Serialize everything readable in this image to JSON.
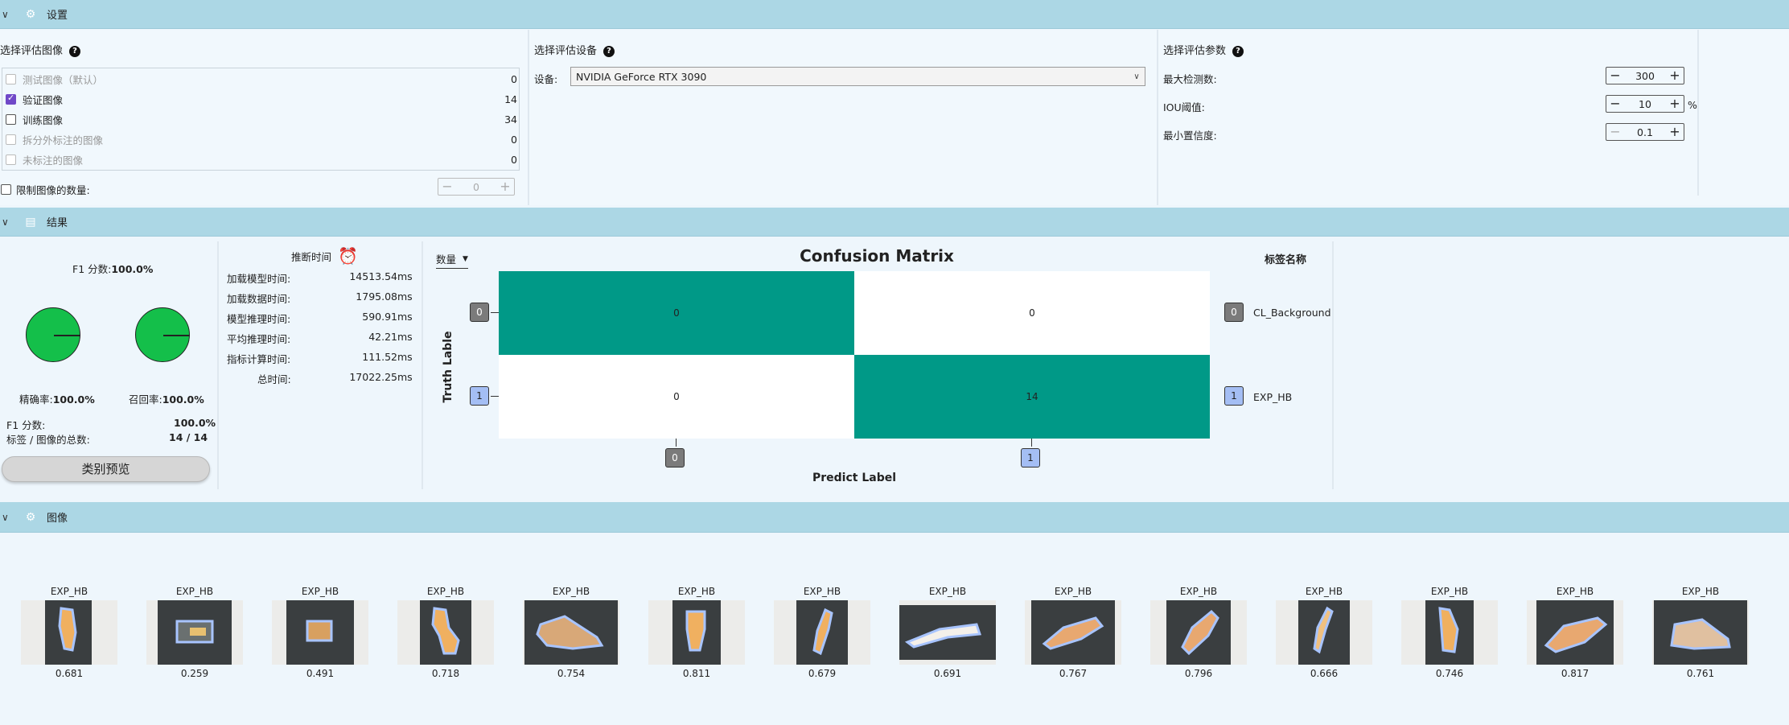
{
  "settings": {
    "title": "设置",
    "images": {
      "heading": "选择评估图像",
      "rows": [
        {
          "name": "测试图像（默认）",
          "count": "0"
        },
        {
          "name": "验证图像",
          "count": "14"
        },
        {
          "name": "训练图像",
          "count": "34"
        },
        {
          "name": "拆分外标注的图像",
          "count": "0"
        },
        {
          "name": "未标注的图像",
          "count": "0"
        }
      ],
      "limit_label": "限制图像的数量:",
      "limit_value": "0"
    },
    "device": {
      "heading": "选择评估设备",
      "label": "设备:",
      "value": "NVIDIA GeForce RTX 3090"
    },
    "params": {
      "heading": "选择评估参数",
      "max_det_label": "最大检测数:",
      "max_det_value": "300",
      "iou_label": "IOU阈值:",
      "iou_value": "10",
      "iou_unit": "%",
      "min_conf_label": "最小置信度:",
      "min_conf_value": "0.1"
    }
  },
  "results": {
    "title": "结果",
    "f1_title_prefix": "F1 分数:",
    "f1_title_value": "100.0%",
    "precision_prefix": "精确率:",
    "precision_value": "100.0%",
    "recall_prefix": "召回率:",
    "recall_value": "100.0%",
    "f1_label": "F1 分数:",
    "f1_value": "100.0%",
    "total_label": "标签 / 图像的总数:",
    "total_value": "14 / 14",
    "preview_button": "类别预览",
    "timing": {
      "title": "推断时间",
      "rows": [
        {
          "label": "加载模型时间:",
          "value": "14513.54",
          "unit": "ms"
        },
        {
          "label": "加载数据时间:",
          "value": "1795.08",
          "unit": "ms"
        },
        {
          "label": "模型推理时间:",
          "value": "590.91",
          "unit": "ms"
        },
        {
          "label": "平均推理时间:",
          "value": "42.21",
          "unit": "ms"
        },
        {
          "label": "指标计算时间:",
          "value": "111.52",
          "unit": "ms"
        },
        {
          "label": "总时间:",
          "value": "17022.25",
          "unit": "ms"
        }
      ]
    },
    "matrix": {
      "mode": "数量",
      "title": "Confusion  Matrix",
      "xlabel": "Predict  Label",
      "ylabel": "Truth  Lable",
      "cells": [
        "0",
        "0",
        "0",
        "14"
      ],
      "row_tags": [
        "0",
        "1"
      ],
      "col_tags": [
        "0",
        "1"
      ],
      "legend_title": "标签名称",
      "legend": [
        {
          "tag": "0",
          "name": "CL_Background"
        },
        {
          "tag": "1",
          "name": "EXP_HB"
        }
      ],
      "colors": {
        "hit": "#009987",
        "miss": "#ffffff"
      }
    }
  },
  "gallery": {
    "title": "图像",
    "items": [
      {
        "label": "EXP_HB",
        "score": "0.681"
      },
      {
        "label": "EXP_HB",
        "score": "0.259"
      },
      {
        "label": "EXP_HB",
        "score": "0.491"
      },
      {
        "label": "EXP_HB",
        "score": "0.718"
      },
      {
        "label": "EXP_HB",
        "score": "0.754"
      },
      {
        "label": "EXP_HB",
        "score": "0.811"
      },
      {
        "label": "EXP_HB",
        "score": "0.679"
      },
      {
        "label": "EXP_HB",
        "score": "0.691"
      },
      {
        "label": "EXP_HB",
        "score": "0.767"
      },
      {
        "label": "EXP_HB",
        "score": "0.796"
      },
      {
        "label": "EXP_HB",
        "score": "0.666"
      },
      {
        "label": "EXP_HB",
        "score": "0.746"
      },
      {
        "label": "EXP_HB",
        "score": "0.817"
      },
      {
        "label": "EXP_HB",
        "score": "0.761"
      }
    ]
  }
}
